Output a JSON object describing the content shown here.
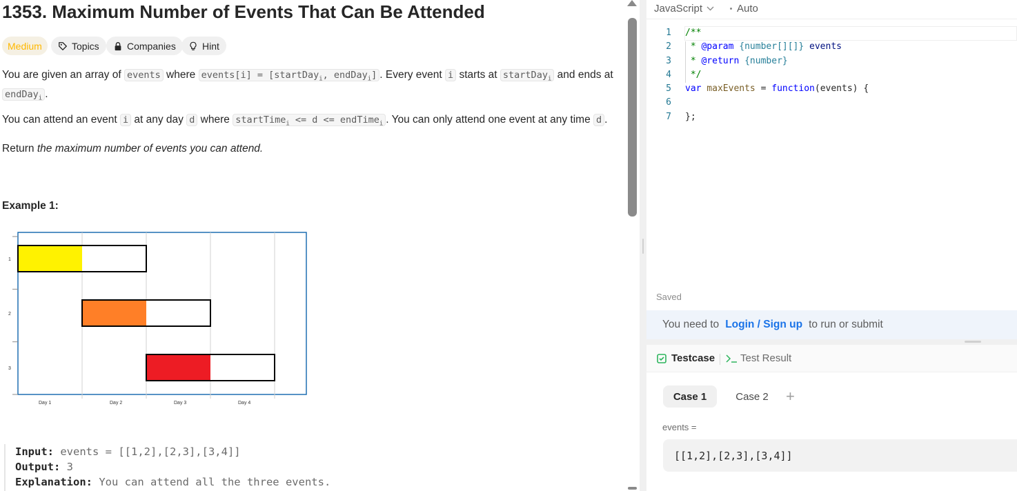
{
  "problem": {
    "title": "1353. Maximum Number of Events That Can Be Attended",
    "chips": {
      "difficulty": "Medium",
      "topics": "Topics",
      "companies": "Companies",
      "hint": "Hint"
    },
    "para1": {
      "t1": "You are given an array of ",
      "c1": "events",
      "t2": " where ",
      "c2": "events[i] = [startDay",
      "c2sub": "i",
      "c2b": ", endDay",
      "c2bsub": "i",
      "c2c": "]",
      "t3": ". Every event ",
      "c3": "i",
      "t4": " starts at ",
      "c4": "startDay",
      "c4sub": "i",
      "t5": " and ends at",
      "c5": "endDay",
      "c5sub": "i",
      "t6": "."
    },
    "para2": {
      "t1": "You can attend an event ",
      "c1": "i",
      "t2": " at any day ",
      "c2": "d",
      "t3": " where ",
      "c3": "startTime",
      "c3sub": "i",
      "c3b": " <= d <= endTime",
      "c3bsub": "i",
      "t4": ". You can only attend one event at any time ",
      "c4": "d",
      "t5": "."
    },
    "para3": {
      "t1": "Return ",
      "em": "the maximum number of events you can attend."
    },
    "example_title": "Example 1:",
    "example": {
      "input_label": "Input:",
      "input_value": "events = [[1,2],[2,3],[3,4]]",
      "output_label": "Output:",
      "output_value": "3",
      "explanation_label": "Explanation:",
      "explanation_value": "You can attend all the three events."
    }
  },
  "chart_data": {
    "type": "gantt",
    "categories": [
      "1",
      "2",
      "3"
    ],
    "x_ticks": [
      "Day 1",
      "Day 2",
      "Day 3",
      "Day 4"
    ],
    "series": [
      {
        "row": "1",
        "start": 1,
        "end": 3,
        "filled_days": 1,
        "color": "#fff200"
      },
      {
        "row": "2",
        "start": 2,
        "end": 4,
        "filled_days": 1,
        "color": "#ff7f27"
      },
      {
        "row": "3",
        "start": 3,
        "end": 5,
        "filled_days": 1,
        "color": "#ed1c24"
      }
    ],
    "grid": true
  },
  "editor": {
    "language": "JavaScript",
    "mode": "Auto",
    "lines": [
      {
        "n": "1"
      },
      {
        "n": "2"
      },
      {
        "n": "3"
      },
      {
        "n": "4"
      },
      {
        "n": "5"
      },
      {
        "n": "6"
      },
      {
        "n": "7"
      }
    ],
    "code": {
      "l1": "/**",
      "l2a": " * ",
      "l2b": "@param",
      "l2c": " ",
      "l2d": "{number[][]}",
      "l2e": " events",
      "l3a": " * ",
      "l3b": "@return",
      "l3c": " ",
      "l3d": "{number}",
      "l4": " */",
      "l5a": "var",
      "l5b": " maxEvents",
      "l5c": " = ",
      "l5d": "function",
      "l5e": "(events) {",
      "l7": "};"
    },
    "saved_label": "Saved"
  },
  "login_bar": {
    "prefix": "You need to",
    "link": "Login / Sign up",
    "suffix": "to run or submit"
  },
  "testcase": {
    "tab_testcase": "Testcase",
    "tab_result": "Test Result",
    "cases": [
      "Case 1",
      "Case 2"
    ],
    "add": "+",
    "var_label": "events =",
    "var_value": "[[1,2],[2,3],[3,4]]"
  },
  "colors": {
    "difficulty": "#ffb800",
    "link": "#1a73e8",
    "testcase_icon": "#2db55d"
  }
}
